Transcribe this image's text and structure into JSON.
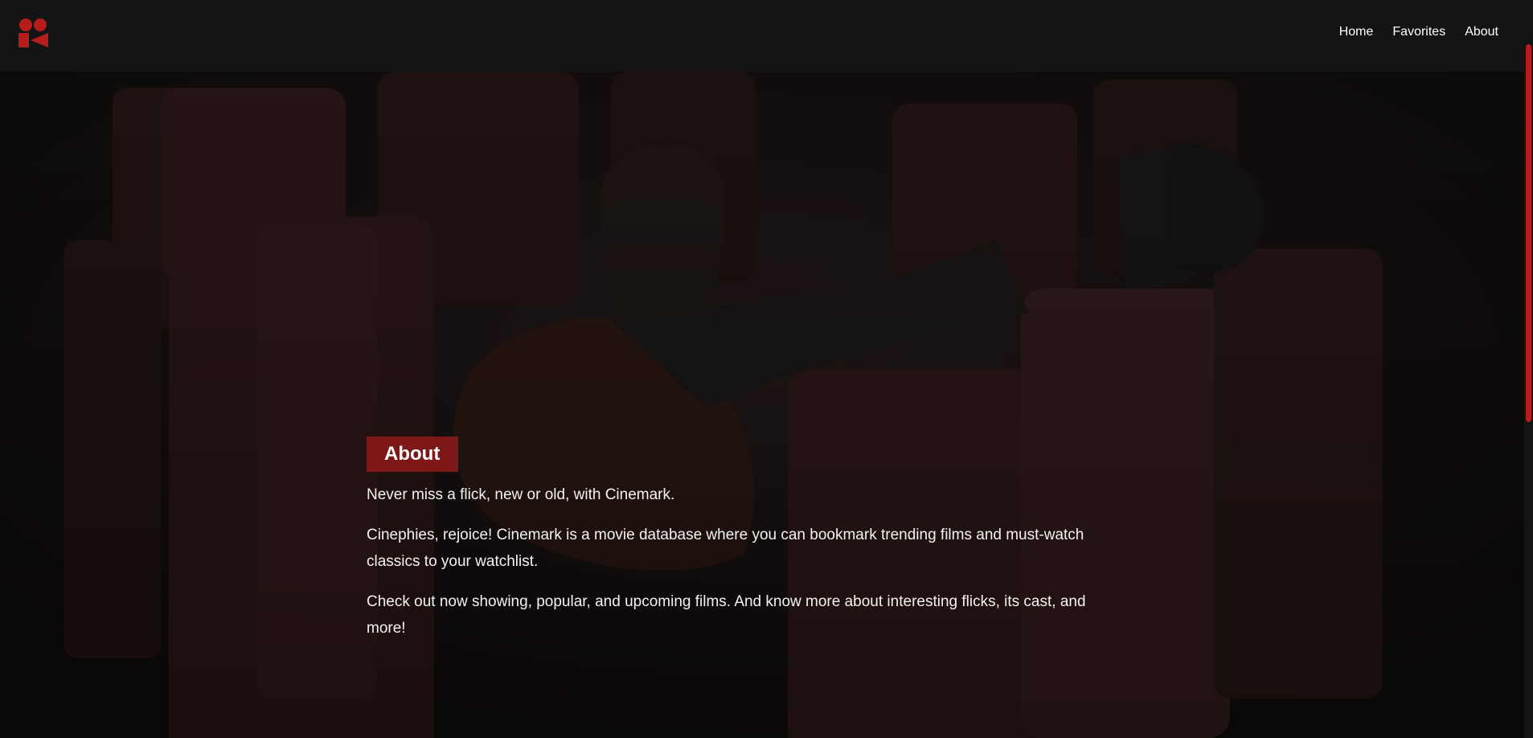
{
  "brand": {
    "accent": "#b51c1c",
    "logo_icon": "film-camera-icon"
  },
  "nav": {
    "items": [
      {
        "label": "Home"
      },
      {
        "label": "Favorites"
      },
      {
        "label": "About"
      }
    ]
  },
  "about": {
    "heading": "About",
    "paragraphs": [
      "Never miss a flick, new or old, with Cinemark.",
      "Cinephies, rejoice! Cinemark is a movie database where you can bookmark trending films and must-watch classics to your watchlist.",
      "Check out now showing, popular, and upcoming films. And know more about interesting flicks, its cast, and more!"
    ]
  },
  "background": {
    "scene": "theater-seats-image"
  }
}
